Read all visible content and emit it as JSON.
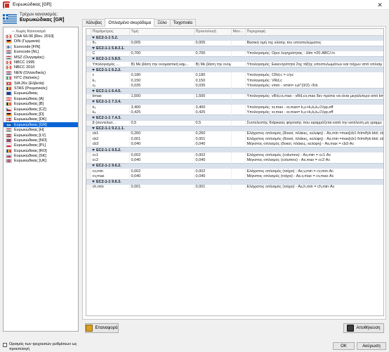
{
  "window": {
    "title": "Ευρωκώδικας [GR]",
    "close_glyph": "✕"
  },
  "current_regulation": {
    "label": "Τρέχων κανονισμός:",
    "value": "Ευρωκώδικας [GR]"
  },
  "regulations": [
    {
      "label": "-- Χωρίς Κανονισμό",
      "flag": "none",
      "selected": false
    },
    {
      "label": "CSA S6-06 [Rev. 2010]",
      "flag": "CA",
      "selected": false
    },
    {
      "label": "DIN (Γερμανία)",
      "flag": "DE",
      "selected": false
    },
    {
      "label": "Eurocode [FIN]",
      "flag": "FI",
      "selected": false
    },
    {
      "label": "Eurocode [NL]",
      "flag": "NL",
      "selected": false
    },
    {
      "label": "MSZ (Ουγγαρίας)",
      "flag": "HU",
      "selected": false
    },
    {
      "label": "NBCC 1995",
      "flag": "CA",
      "selected": false
    },
    {
      "label": "NBCC 2010",
      "flag": "CA",
      "selected": false
    },
    {
      "label": "NEN (Ολλανδικός)",
      "flag": "NL",
      "selected": false
    },
    {
      "label": "NTC (Ιταλικός)",
      "flag": "IT",
      "selected": false
    },
    {
      "label": "SIA 26x (Ελβετία)",
      "flag": "CH",
      "selected": false
    },
    {
      "label": "STAS (Ρουμανικός)",
      "flag": "RO",
      "selected": false
    },
    {
      "label": "Ευρωκώδικας",
      "flag": "EU",
      "selected": false
    },
    {
      "label": "Ευρωκώδικας [A]",
      "flag": "AT",
      "selected": false
    },
    {
      "label": "Ευρωκώδικας [B]",
      "flag": "BE",
      "selected": false
    },
    {
      "label": "Ευρωκώδικας [CZ]",
      "flag": "CZ",
      "selected": false
    },
    {
      "label": "Ευρωκώδικας [D]",
      "flag": "DE",
      "selected": false
    },
    {
      "label": "Ευρωκώδικας [DK]",
      "flag": "DK",
      "selected": false
    },
    {
      "label": "Ευρωκώδικας [GR]",
      "flag": "GR",
      "selected": true
    },
    {
      "label": "Ευρωκώδικας [H]",
      "flag": "HU",
      "selected": false
    },
    {
      "label": "Ευρωκώδικας [LV]",
      "flag": "LV",
      "selected": false
    },
    {
      "label": "Ευρωκώδικας [NO]",
      "flag": "NO",
      "selected": false
    },
    {
      "label": "Ευρωκώδικας [PL]",
      "flag": "PL",
      "selected": false
    },
    {
      "label": "Ευρωκώδικας [RO]",
      "flag": "RO",
      "selected": false
    },
    {
      "label": "Ευρωκώδικας [SK]",
      "flag": "SK",
      "selected": false
    },
    {
      "label": "Ευρωκώδικας [UK]",
      "flag": "UK",
      "selected": false
    }
  ],
  "tabs": [
    {
      "label": "Χάλυβας",
      "active": false
    },
    {
      "label": "Οπλισμένο σκυρόδεμα",
      "active": true
    },
    {
      "label": "Ξύλο",
      "active": false
    },
    {
      "label": "Τοιχοποιία",
      "active": false
    }
  ],
  "table": {
    "columns": [
      "Παράμετρος",
      "Τιμή",
      "Προεπιλογή",
      "Μον...",
      "Περιγραφή"
    ],
    "rows": [
      {
        "type": "group",
        "label": "EC2-1-1 5.2."
      },
      {
        "type": "row",
        "cells": [
          "θ₀",
          "0,005",
          "0,005",
          "",
          "Βασική τιμή της κλίσης του υποστυλώματος"
        ]
      },
      {
        "type": "group",
        "label": "EC2-1-1 5.8.3.1."
      },
      {
        "type": "row",
        "cells": [
          "C",
          "0,700",
          "0,700",
          "",
          "Υπολογισμός: Οριο λυγηρότητας - λlim =20·ABC/√n"
        ]
      },
      {
        "type": "group",
        "label": "EC2-1-1 5.8.5."
      },
      {
        "type": "row",
        "cells": [
          "Υπολογισμός ...",
          "B) Με βάση την ονομαστική καμ...",
          "B) Με βάση την ονομαστικ...",
          "",
          "Υπολογισμός: Εκκεντρότητα 2ης τάξης υποστυλωμάτων και τοίχων από οπλισμ"
        ]
      },
      {
        "type": "group",
        "label": "EC2-1-1 6.2.2."
      },
      {
        "type": "row",
        "cells": [
          "c",
          "0,180",
          "0,180",
          "",
          "Υπολογισμός: CRd,c = c/γc"
        ]
      },
      {
        "type": "row",
        "cells": [
          "k₁",
          "0,150",
          "0,150",
          "",
          "Υπολογισμός: VRd,c"
        ]
      },
      {
        "type": "row",
        "cells": [
          "cᵥ",
          "0,035",
          "0,035",
          "",
          "Υπολογισμός: vmin - vmin= cᵥk^(3/2)·√fck"
        ]
      },
      {
        "type": "group",
        "label": "EC2-1-1 6.4.5."
      },
      {
        "type": "row",
        "cells": [
          "kmax",
          "1,500",
          "1,500",
          "",
          "Υπολογισμός: vRd,cs,max - vRd,cs,max δεν πρέπει να είναι μεγαλύτερο από kmax·vRd,c"
        ]
      },
      {
        "type": "group",
        "label": "EC2-1-1 7.3.4."
      },
      {
        "type": "row",
        "cells": [
          "k₃",
          "3,400",
          "3,400",
          "",
          "Υπολογισμός: sr,max - sr,max= k₃c+k₁k₂k₄∅/ρp,eff"
        ]
      },
      {
        "type": "row",
        "cells": [
          "k₄",
          "0,425",
          "0,425",
          "",
          "Υπολογισμός: sr,max - sr,max= k₃c+k₁k₂k₄∅/ρp,eff"
        ]
      },
      {
        "type": "group",
        "label": "EC2-1-1 7.4.3."
      },
      {
        "type": "row",
        "cells": [
          "β (συντελεσ...",
          "0,5",
          "0,5",
          "",
          "Συντελεστής διάρκειας φόρτισης που εφαρμόζεται κατά την εκτέλεση μη γραμμι"
        ]
      },
      {
        "type": "group",
        "label": "EC2-1-1 9.2.1.1."
      },
      {
        "type": "row",
        "cells": [
          "cb1",
          "0,260",
          "0,260",
          "",
          "Ελάχιστος οπλισμός (δοκοί, πλάκες, κελύφη) - As,min =max[cb1·fctm/fyk·btd; cb2·btd]"
        ]
      },
      {
        "type": "row",
        "cells": [
          "cb2",
          "0,001",
          "0,001",
          "",
          "Ελάχιστος οπλισμός (δοκοί, πλάκες, κελύφη) - As,min =max[cb1·fctm/fyk·btd; cb2·btd]"
        ]
      },
      {
        "type": "row",
        "cells": [
          "cb3",
          "0,040",
          "0,040",
          "",
          "Μέγιστος οπλισμός (δοκοί, πλάκες, κελύφη) - As,max = cb3·Ac"
        ]
      },
      {
        "type": "group",
        "label": "EC2-1-1 9.5.2."
      },
      {
        "type": "row",
        "cells": [
          "cc1",
          "0,002",
          "0,002",
          "",
          "Ελάχιστος οπλισμός (columns) - As,min = cc1·Ac"
        ]
      },
      {
        "type": "row",
        "cells": [
          "cc2",
          "0,040",
          "0,040",
          "",
          "Μέγιστος οπλισμός (columns) - As,max = cc2·Ac"
        ]
      },
      {
        "type": "group",
        "label": "EC2-1-1 9.6.2."
      },
      {
        "type": "row",
        "cells": [
          "cv,min",
          "0,002",
          "0,002",
          "",
          "Ελάχιστος οπλισμός (τοίχοι) - As,v,min = cv,min·Ac"
        ]
      },
      {
        "type": "row",
        "cells": [
          "cv,max",
          "0,040",
          "0,040",
          "",
          "Μέγιστος οπλισμός (τοίχοι) - As,v,max = cv,max·Ac"
        ]
      },
      {
        "type": "group",
        "label": "EC2-1-1 9.6.3."
      },
      {
        "type": "row",
        "cells": [
          "ch,min",
          "0,001",
          "0,001",
          "",
          "Ελάχιστος οπλισμός (τοίχοι) - As,h,min = ch,min·Ac"
        ]
      }
    ]
  },
  "buttons": {
    "reset_label": "Επαναφορά",
    "save_label": "Αποθήκευση",
    "ok_label": "OK",
    "cancel_label": "Ακύρωση"
  },
  "default_checkbox": {
    "label": "Ορισμός των τρεχουσών ρυθμίσεων ως προεπιλογή",
    "checked": false
  },
  "colors": {
    "selection": "#0a64d6",
    "group_row": "#d9e1ec",
    "app_icon": "#c6322a"
  }
}
